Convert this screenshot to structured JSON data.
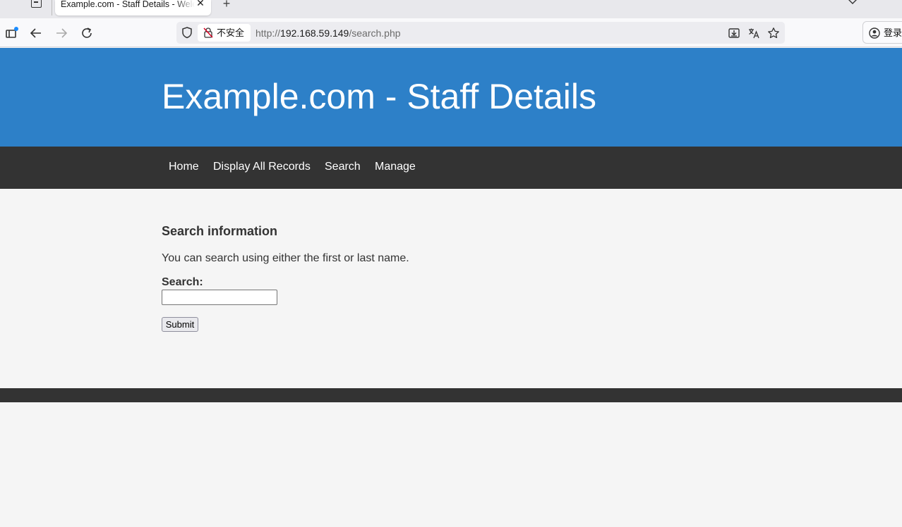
{
  "browser": {
    "tab": {
      "title": "Example.com - Staff Details - Welcome"
    },
    "security_label": "不安全",
    "url": {
      "scheme": "http://",
      "host": "192.168.59.149",
      "path": "/search.php"
    },
    "login_label": "登录"
  },
  "site": {
    "title": "Example.com - Staff Details",
    "nav": [
      {
        "label": "Home"
      },
      {
        "label": "Display All Records"
      },
      {
        "label": "Search"
      },
      {
        "label": "Manage"
      }
    ],
    "colors": {
      "header": "#2d80c8",
      "nav": "#333333",
      "background": "#f5f5f5"
    }
  },
  "search": {
    "heading": "Search information",
    "description": "You can search using either the first or last name.",
    "field_label": "Search:",
    "value": "",
    "submit_label": "Submit"
  }
}
